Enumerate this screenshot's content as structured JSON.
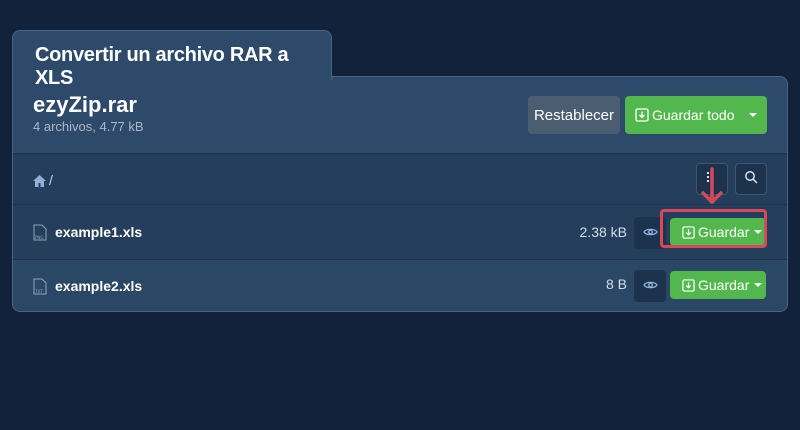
{
  "tab_title": "Convertir un archivo RAR a XLS",
  "archive": {
    "name": "ezyZip.rar",
    "meta": "4 archivos, 4.77 kB"
  },
  "toolbar": {
    "reset_label": "Restablecer",
    "save_all_label": "Guardar todo"
  },
  "path": {
    "separator": "/"
  },
  "files": [
    {
      "type_label": "PNG",
      "name": "example1.xls",
      "size": "2.38 kB",
      "save_label": "Guardar"
    },
    {
      "type_label": "TXT",
      "name": "example2.xls",
      "size": "8 B",
      "save_label": "Guardar"
    }
  ],
  "colors": {
    "background": "#11223a",
    "panel": "#2d4a6a",
    "accent_green": "#52b84d",
    "reset_gray": "#4b5d71",
    "highlight_red": "#d9475a"
  },
  "icons": [
    "home-icon",
    "list-view-icon",
    "search-icon",
    "download-icon",
    "eye-icon",
    "file-icon",
    "arrow-down-icon"
  ]
}
